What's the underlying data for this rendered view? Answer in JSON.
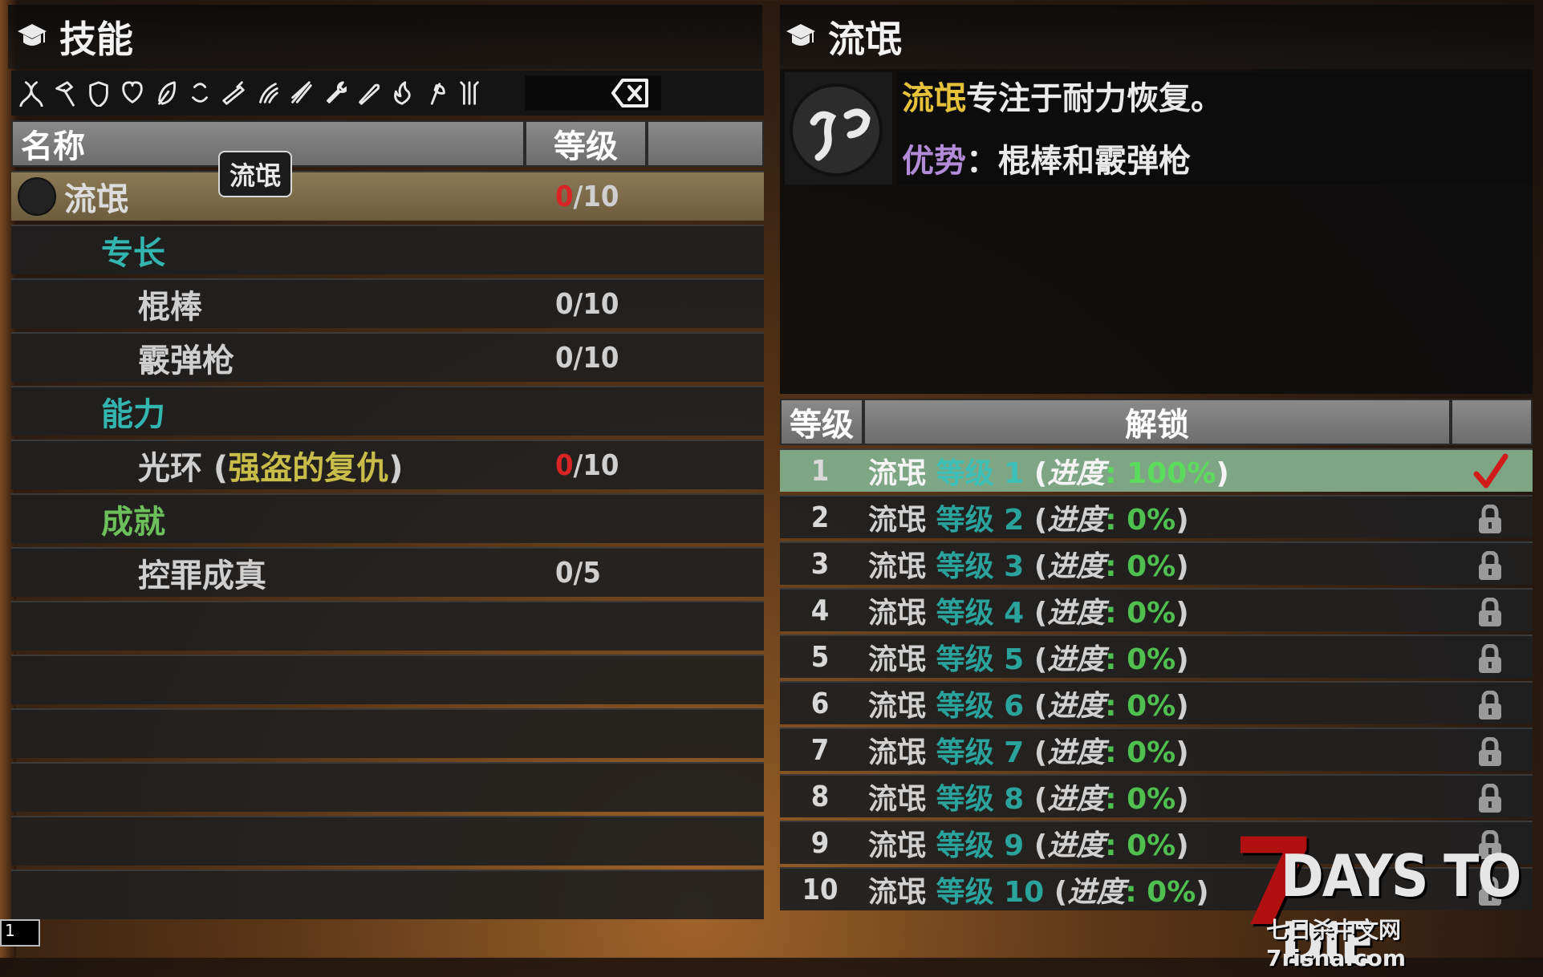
{
  "left_panel": {
    "title": "技能",
    "filter_icons": [
      "dna-icon",
      "hammer-icon",
      "shield-icon",
      "heart-shield-icon",
      "feather-icon",
      "bracelet-icon",
      "shotgun-icon",
      "claw-icon",
      "arrows-icon",
      "wrench-icon",
      "knife-icon",
      "fire-icon",
      "axe-icon",
      "spear-icon"
    ],
    "columns": {
      "name": "名称",
      "level": "等级",
      "extra": ""
    },
    "tooltip": "流氓",
    "rows": [
      {
        "type": "skill",
        "name": "流氓",
        "level_cur": "0",
        "level_max": "/10"
      },
      {
        "type": "category",
        "name": "专长",
        "color": "#33b5b0"
      },
      {
        "type": "item",
        "name": "棍棒",
        "level": "0/10"
      },
      {
        "type": "item",
        "name": "霰弹枪",
        "level": "0/10"
      },
      {
        "type": "category",
        "name": "能力",
        "color": "#33b5b0"
      },
      {
        "type": "ability",
        "name_prefix": "光环 (",
        "name_highlight": "强盗的复仇",
        "name_suffix": ")",
        "level_cur": "0",
        "level_max": "/10"
      },
      {
        "type": "category",
        "name": "成就",
        "color": "#6cc05a"
      },
      {
        "type": "item",
        "name": "控罪成真",
        "level": "0/5"
      }
    ],
    "empty_rows": 6
  },
  "right_panel": {
    "title": "流氓",
    "description": {
      "highlight": "流氓",
      "text": "专注于耐力恢复。",
      "adv_label": "优势",
      "adv_sep": "：",
      "adv_text": "棍棒和霰弹枪"
    },
    "columns": {
      "level": "等级",
      "unlock": "解锁",
      "status": ""
    },
    "levels": [
      {
        "num": "1",
        "name": "流氓",
        "lvl": "等级 1",
        "paren_open": "(",
        "progress_label": "进度",
        "progress": ": 100%",
        "paren_close": ")",
        "done": true
      },
      {
        "num": "2",
        "name": "流氓",
        "lvl": "等级 2",
        "paren_open": "(",
        "progress_label": "进度",
        "progress": ": 0%",
        "paren_close": ")",
        "done": false
      },
      {
        "num": "3",
        "name": "流氓",
        "lvl": "等级 3",
        "paren_open": "(",
        "progress_label": "进度",
        "progress": ": 0%",
        "paren_close": ")",
        "done": false
      },
      {
        "num": "4",
        "name": "流氓",
        "lvl": "等级 4",
        "paren_open": "(",
        "progress_label": "进度",
        "progress": ": 0%",
        "paren_close": ")",
        "done": false
      },
      {
        "num": "5",
        "name": "流氓",
        "lvl": "等级 5",
        "paren_open": "(",
        "progress_label": "进度",
        "progress": ": 0%",
        "paren_close": ")",
        "done": false
      },
      {
        "num": "6",
        "name": "流氓",
        "lvl": "等级 6",
        "paren_open": "(",
        "progress_label": "进度",
        "progress": ": 0%",
        "paren_close": ")",
        "done": false
      },
      {
        "num": "7",
        "name": "流氓",
        "lvl": "等级 7",
        "paren_open": "(",
        "progress_label": "进度",
        "progress": ": 0%",
        "paren_close": ")",
        "done": false
      },
      {
        "num": "8",
        "name": "流氓",
        "lvl": "等级 8",
        "paren_open": "(",
        "progress_label": "进度",
        "progress": ": 0%",
        "paren_close": ")",
        "done": false
      },
      {
        "num": "9",
        "name": "流氓",
        "lvl": "等级 9",
        "paren_open": "(",
        "progress_label": "进度",
        "progress": ": 0%",
        "paren_close": ")",
        "done": false
      },
      {
        "num": "10",
        "name": "流氓",
        "lvl": "等级 10",
        "paren_open": "(",
        "progress_label": "进度",
        "progress": ": 0%",
        "paren_close": ")",
        "done": false
      }
    ]
  },
  "watermark": {
    "seven": "7",
    "main": "DAYS TO DIE",
    "sub": "七日杀中文网7risha.com"
  },
  "corner_counter": "1",
  "colors": {
    "accent_teal": "#33b5b0",
    "accent_green": "#6cc05a",
    "done_row": "#7ea685",
    "red": "#d82424",
    "amber": "#e6c23a",
    "purple": "#b18ad8"
  }
}
